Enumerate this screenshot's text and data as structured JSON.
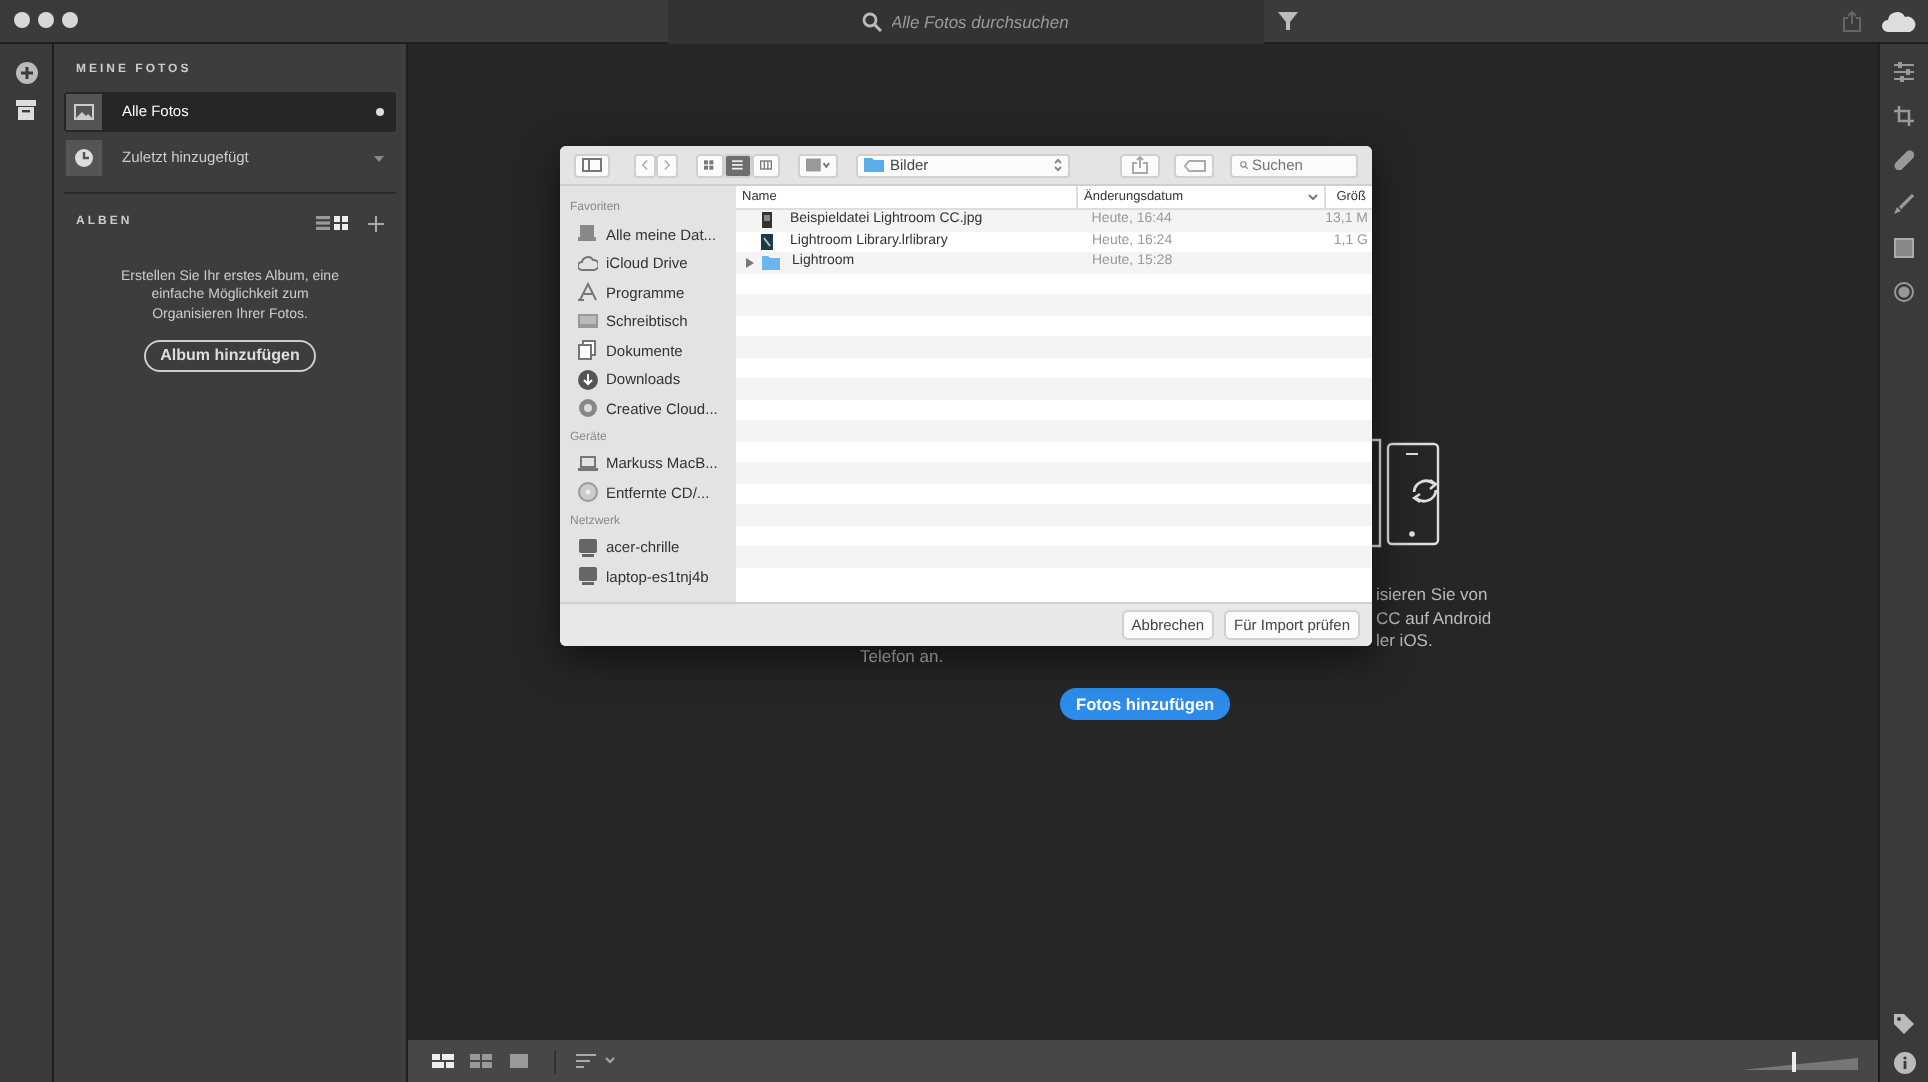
{
  "top_bar": {
    "search_placeholder": "Alle Fotos durchsuchen"
  },
  "sidebar": {
    "heading": "MEINE FOTOS",
    "items": [
      {
        "label": "Alle Fotos",
        "kind": "photos",
        "selected": true
      },
      {
        "label": "Zuletzt hinzugefügt",
        "kind": "recent",
        "selected": false
      }
    ],
    "albums": {
      "heading": "ALBEN",
      "view_options": [
        {
          "kind": "list",
          "selected": false
        },
        {
          "kind": "grid",
          "selected": true
        }
      ],
      "message": "Erstellen Sie Ihr erstes Album, eine einfache Möglichkeit zum Organisieren Ihrer Fotos.",
      "button": "Album hinzufügen"
    }
  },
  "main": {
    "hint_left": "Telefon an.",
    "hint_right": [
      "isieren Sie von",
      "CC auf Android",
      "ler iOS."
    ],
    "button": "Fotos hinzufügen"
  },
  "dialog": {
    "view_modes": [
      {
        "kind": "icons",
        "selected": false
      },
      {
        "kind": "list",
        "selected": true
      },
      {
        "kind": "columns",
        "selected": false
      }
    ],
    "location": "Bilder",
    "search_placeholder": "Suchen",
    "sidebar": [
      {
        "title": "Favoriten",
        "items": [
          {
            "label": "Alle meine Dat...",
            "kind": "files"
          },
          {
            "label": "iCloud Drive",
            "kind": "cloud"
          },
          {
            "label": "Programme",
            "kind": "apps"
          },
          {
            "label": "Schreibtisch",
            "kind": "desktop"
          },
          {
            "label": "Dokumente",
            "kind": "docs"
          },
          {
            "label": "Downloads",
            "kind": "download"
          },
          {
            "label": "Creative Cloud...",
            "kind": "cc"
          }
        ]
      },
      {
        "title": "Geräte",
        "items": [
          {
            "label": "Markuss MacB...",
            "kind": "laptop"
          },
          {
            "label": "Entfernte CD/...",
            "kind": "disc"
          }
        ]
      },
      {
        "title": "Netzwerk",
        "items": [
          {
            "label": "acer-chrille",
            "kind": "computer"
          },
          {
            "label": "laptop-es1tnj4b",
            "kind": "computer"
          }
        ]
      }
    ],
    "columns": [
      "Name",
      "Änderungsdatum",
      "Größ"
    ],
    "rows": [
      {
        "name": "Beispieldatei Lightroom CC.jpg",
        "date": "Heute, 16:44",
        "size": "13,1 M",
        "kind": "image"
      },
      {
        "name": "Lightroom Library.lrlibrary",
        "date": "Heute, 16:24",
        "size": "1,1 G",
        "kind": "library"
      },
      {
        "name": "Lightroom",
        "date": "Heute, 15:28",
        "kind": "folder",
        "expanded": false
      }
    ],
    "buttons": [
      "Abbrechen",
      "Für Import prüfen"
    ]
  },
  "bottom_bar": {
    "views": [
      {
        "kind": "detail",
        "selected": true
      },
      {
        "kind": "grid",
        "selected": false
      },
      {
        "kind": "single",
        "selected": false
      }
    ],
    "zoom_slider": {
      "level": 0.45
    }
  }
}
